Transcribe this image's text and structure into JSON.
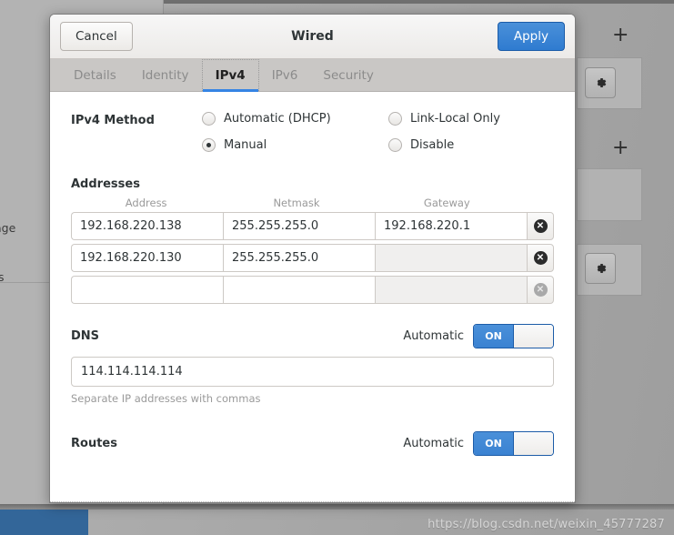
{
  "dialog": {
    "title": "Wired",
    "cancel_label": "Cancel",
    "apply_label": "Apply",
    "tabs": [
      {
        "label": "Details",
        "active": false
      },
      {
        "label": "Identity",
        "active": false
      },
      {
        "label": "IPv4",
        "active": true
      },
      {
        "label": "IPv6",
        "active": false
      },
      {
        "label": "Security",
        "active": false
      }
    ],
    "method": {
      "label": "IPv4 Method",
      "options": [
        {
          "label": "Automatic (DHCP)",
          "selected": false
        },
        {
          "label": "Link-Local Only",
          "selected": false
        },
        {
          "label": "Manual",
          "selected": true
        },
        {
          "label": "Disable",
          "selected": false
        }
      ]
    },
    "addresses": {
      "heading": "Addresses",
      "columns": [
        "Address",
        "Netmask",
        "Gateway"
      ],
      "rows": [
        {
          "address": "192.168.220.138",
          "netmask": "255.255.255.0",
          "gateway": "192.168.220.1",
          "gateway_dim": false,
          "delete_disabled": false
        },
        {
          "address": "192.168.220.130",
          "netmask": "255.255.255.0",
          "gateway": "",
          "gateway_dim": true,
          "delete_disabled": false
        },
        {
          "address": "",
          "netmask": "",
          "gateway": "",
          "gateway_dim": true,
          "delete_disabled": true
        }
      ],
      "delete_icon": "delete-circle-icon"
    },
    "dns": {
      "heading": "DNS",
      "automatic_label": "Automatic",
      "toggle_state": "ON",
      "value": "114.114.114.114",
      "hint": "Separate IP addresses with commas"
    },
    "routes": {
      "heading": "Routes",
      "automatic_label": "Automatic",
      "toggle_state": "ON"
    }
  },
  "background": {
    "plus_label": "+",
    "gear_icon": "gear-icon",
    "text_fragments": [
      "age",
      "s"
    ]
  },
  "watermark": "https://blog.csdn.net/weixin_45777287",
  "colors": {
    "accent": "#3584e4",
    "apply_button": "#3a82d2",
    "taskbar": "#336699"
  }
}
